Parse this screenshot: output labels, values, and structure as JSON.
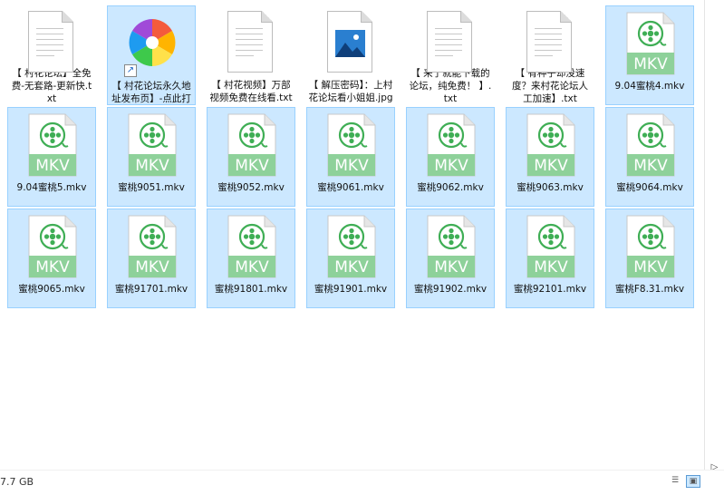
{
  "files": [
    {
      "label": "【 村花论坛】全免费-无套路-更新快.txt",
      "type": "txt",
      "selected": false
    },
    {
      "label": "【 村花论坛永久地址发布页】-点此打开",
      "type": "shortcut",
      "selected": true
    },
    {
      "label": "【 村花视频】万部视频免费在线看.txt",
      "type": "txt",
      "selected": false
    },
    {
      "label": "【 解压密码】：上村花论坛看小姐姐.jpg",
      "type": "jpg",
      "selected": false
    },
    {
      "label": "【 来了就能下载的论坛，纯免费！ 】.txt",
      "type": "txt",
      "selected": false
    },
    {
      "label": "【 有种子却没速度？来村花论坛人工加速】.txt",
      "type": "txt",
      "selected": false
    },
    {
      "label": "9.04蜜桃4.mkv",
      "type": "mkv",
      "selected": true
    },
    {
      "label": "9.04蜜桃5.mkv",
      "type": "mkv",
      "selected": true
    },
    {
      "label": "蜜桃9051.mkv",
      "type": "mkv",
      "selected": true
    },
    {
      "label": "蜜桃9052.mkv",
      "type": "mkv",
      "selected": true
    },
    {
      "label": "蜜桃9061.mkv",
      "type": "mkv",
      "selected": true
    },
    {
      "label": "蜜桃9062.mkv",
      "type": "mkv",
      "selected": true
    },
    {
      "label": "蜜桃9063.mkv",
      "type": "mkv",
      "selected": true
    },
    {
      "label": "蜜桃9064.mkv",
      "type": "mkv",
      "selected": true
    },
    {
      "label": "蜜桃9065.mkv",
      "type": "mkv",
      "selected": true
    },
    {
      "label": "蜜桃91701.mkv",
      "type": "mkv",
      "selected": true
    },
    {
      "label": "蜜桃91801.mkv",
      "type": "mkv",
      "selected": true
    },
    {
      "label": "蜜桃91901.mkv",
      "type": "mkv",
      "selected": true
    },
    {
      "label": "蜜桃91902.mkv",
      "type": "mkv",
      "selected": true
    },
    {
      "label": "蜜桃92101.mkv",
      "type": "mkv",
      "selected": true
    },
    {
      "label": "蜜桃F8.31.mkv",
      "type": "mkv",
      "selected": true
    }
  ],
  "mkv_badge": "MKV",
  "colors": {
    "selection_bg": "#cce8ff",
    "selection_border": "#99d1ff",
    "mkv_green": "#8ed19a",
    "mkv_symbol": "#3fae55"
  },
  "statusbar": {
    "size_text": "7.7 GB",
    "details_view_icon": "details-view-icon",
    "large_icons_view_icon": "large-icons-view-icon"
  }
}
